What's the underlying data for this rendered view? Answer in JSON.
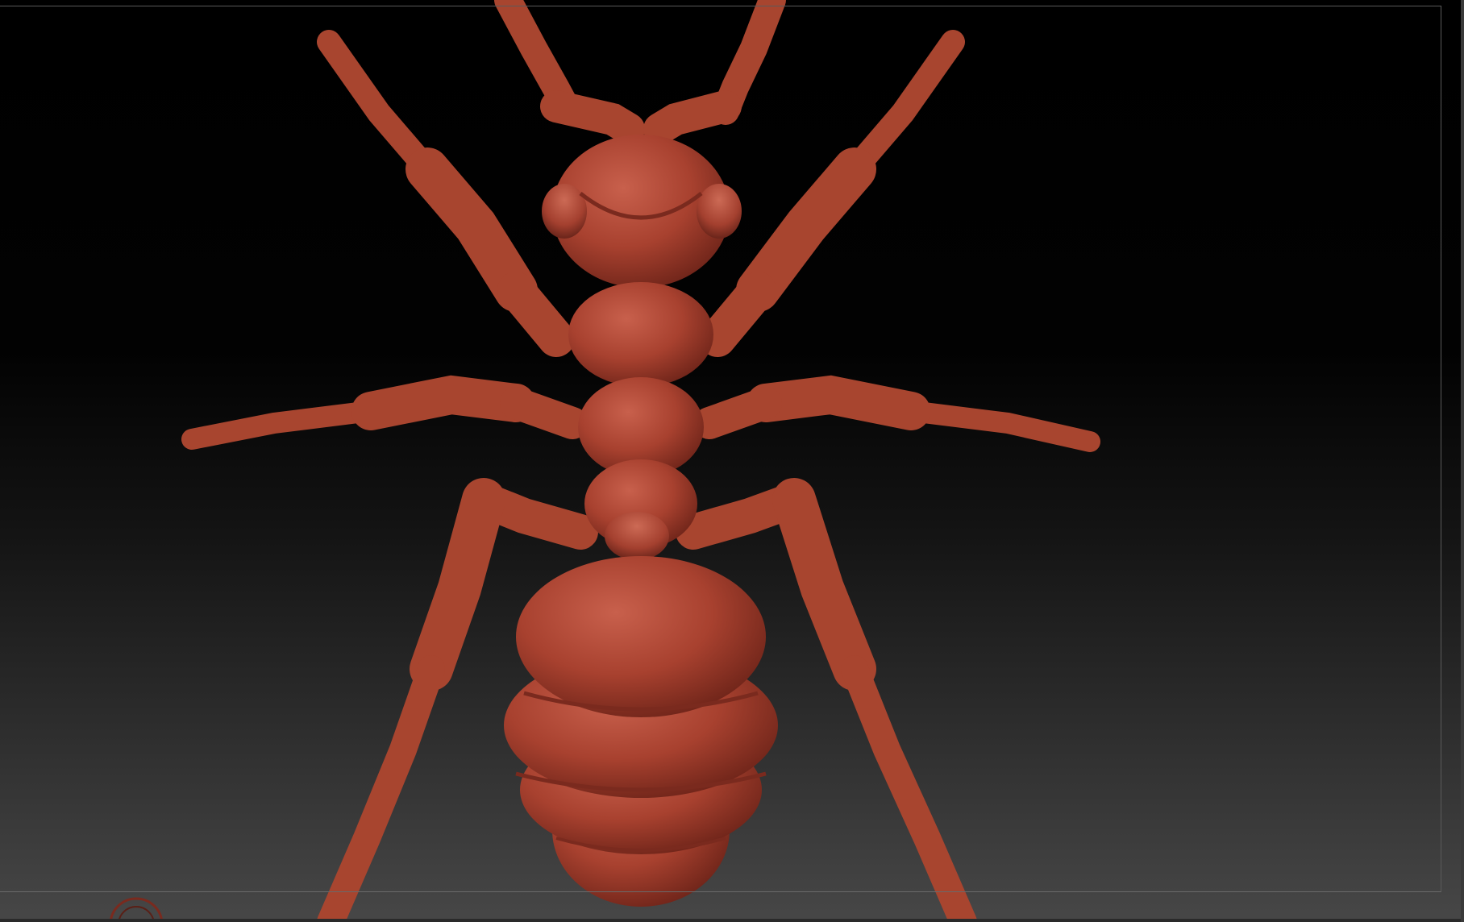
{
  "viewport": {
    "model_name": "",
    "model_color": "#b44a3a",
    "background_top": "#000000",
    "background_bottom": "#474747"
  },
  "icons": {
    "gizmo": "axis-gizmo-icon"
  }
}
